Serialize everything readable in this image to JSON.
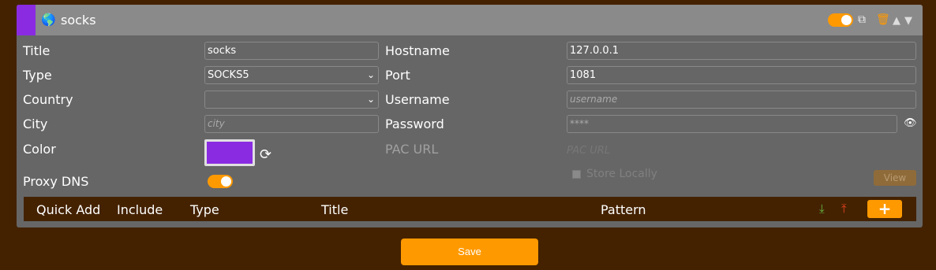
{
  "proxy": {
    "title": "socks",
    "accent_color": "#8a2be2",
    "enabled": true
  },
  "fields": {
    "title_label": "Title",
    "title_value": "socks",
    "type_label": "Type",
    "type_value": "SOCKS5",
    "country_label": "Country",
    "country_value": "",
    "city_label": "City",
    "city_placeholder": "city",
    "color_label": "Color",
    "proxy_dns_label": "Proxy DNS",
    "proxy_dns_enabled": true,
    "hostname_label": "Hostname",
    "hostname_value": "127.0.0.1",
    "port_label": "Port",
    "port_value": "1081",
    "username_label": "Username",
    "username_placeholder": "username",
    "password_label": "Password",
    "password_placeholder": "****",
    "pac_url_label": "PAC URL",
    "pac_url_placeholder": "PAC URL",
    "store_locally_label": "Store Locally",
    "view_label": "View"
  },
  "patterns_bar": {
    "columns": [
      "Quick Add",
      "Include",
      "Type",
      "Title",
      "Pattern"
    ],
    "add_label": "+"
  },
  "save_label": "Save",
  "colors": {
    "background": "#442200",
    "panel": "#666666",
    "header": "#8a8a8a",
    "accent": "#ff9900"
  },
  "icons": {
    "globe": "globe-icon",
    "toggle": "toggle-switch",
    "duplicate": "duplicate-icon",
    "delete": "trash-icon",
    "move_up": "triangle-up-icon",
    "move_down": "triangle-down-icon",
    "refresh": "refresh-icon",
    "show_password": "eye-icon",
    "import": "import-icon",
    "export": "export-icon"
  }
}
